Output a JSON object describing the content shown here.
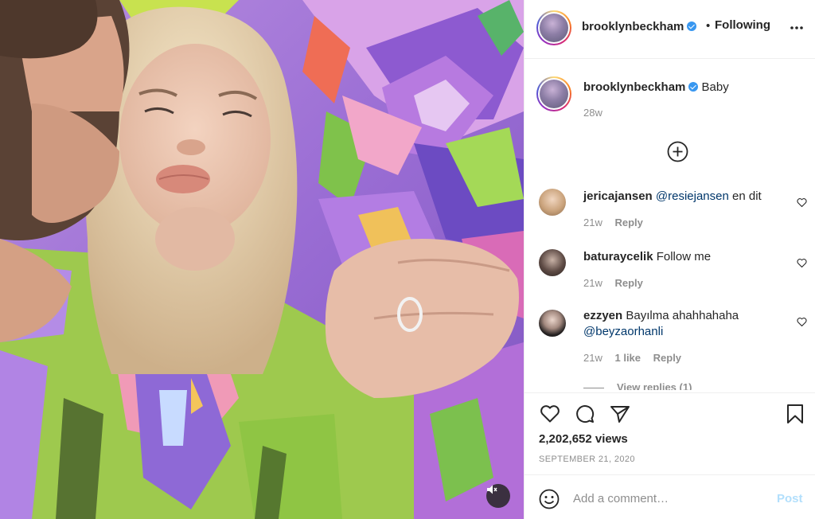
{
  "post": {
    "username": "brooklynbeckham",
    "follow_separator": "•",
    "follow_status": "Following",
    "more_icon": "more-horizontal-icon",
    "caption": "Baby",
    "caption_age": "28w"
  },
  "comments": [
    {
      "username": "jericajansen",
      "mention": "@resiejansen",
      "text": " en dit",
      "age": "21w",
      "likes": "",
      "reply_label": "Reply"
    },
    {
      "username": "baturaycelik",
      "mention": "",
      "text": "Follow me",
      "age": "21w",
      "likes": "",
      "reply_label": "Reply"
    },
    {
      "username": "ezzyen",
      "text": "Bayılma ahahhahaha",
      "mention": "@beyzaorhanli",
      "age": "21w",
      "likes": "1 like",
      "reply_label": "Reply"
    }
  ],
  "view_replies": "View replies (1)",
  "stats": {
    "views": "2,202,652 views",
    "date": "SEPTEMBER 21, 2020"
  },
  "composer": {
    "placeholder": "Add a comment…",
    "post_label": "Post"
  },
  "icons": {
    "like": "heart-icon",
    "comment": "comment-icon",
    "share": "share-icon",
    "save": "bookmark-icon",
    "emoji": "emoji-icon",
    "mute": "speaker-muted-icon",
    "load_more": "plus-circle-icon"
  },
  "colors": {
    "verified": "#3897f0",
    "link": "#00376b",
    "muted_text": "#8e8e8e",
    "post_disabled": "#b2dffc"
  }
}
